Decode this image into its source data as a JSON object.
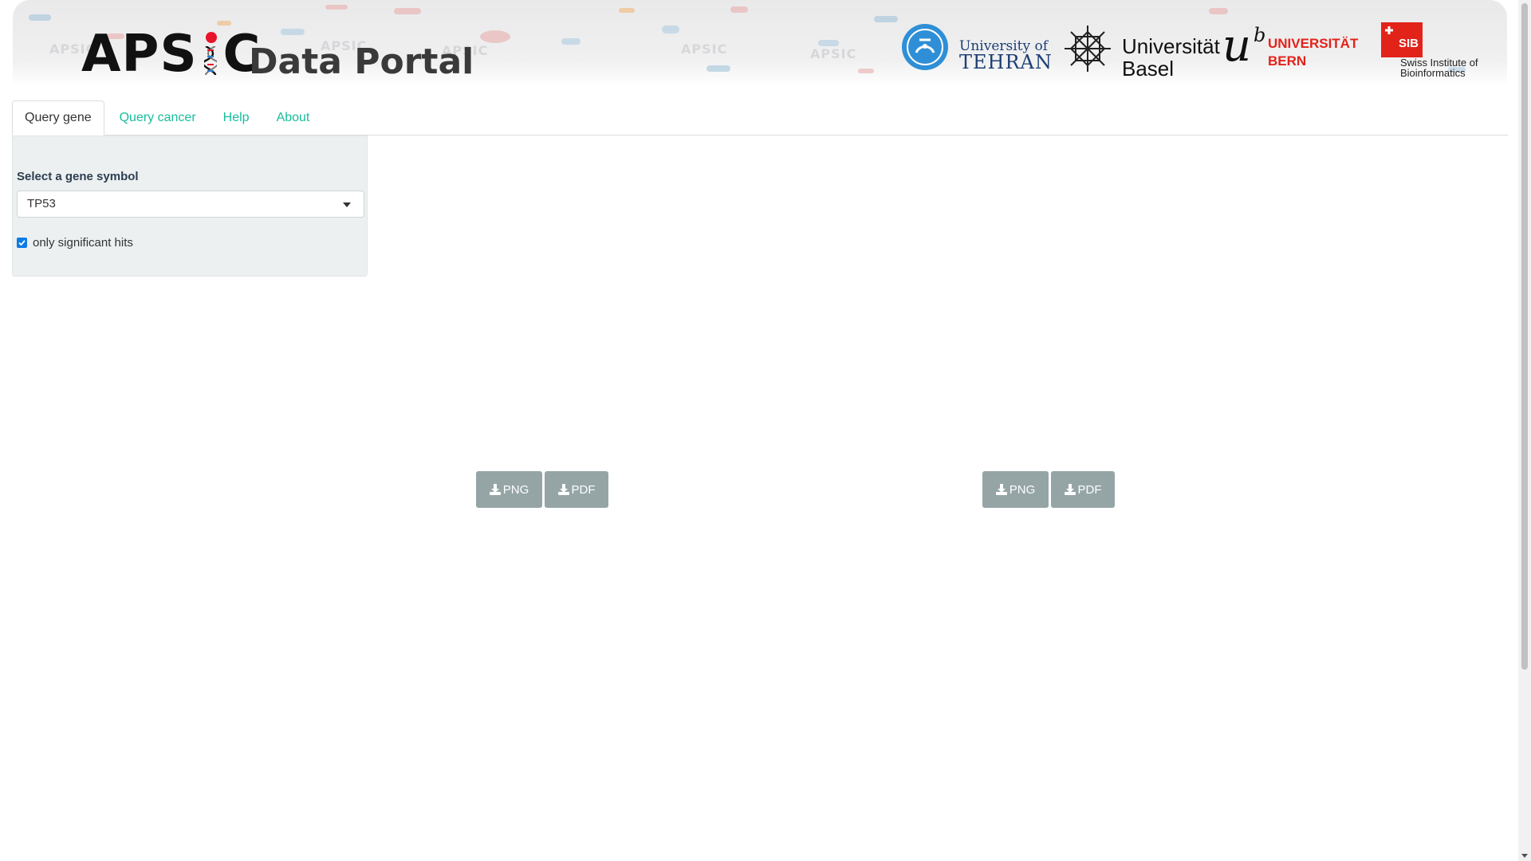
{
  "header": {
    "logo_main": "APSIC",
    "logo_left": "APS",
    "logo_right": "C",
    "logo_sub": "Data Portal",
    "watermark_text": "APSIC",
    "partners": {
      "tehran_line1": "University of",
      "tehran_line2": "TEHRAN",
      "basel_line1": "Universität",
      "basel_line2": "Basel",
      "bern_u": "u",
      "bern_b": "b",
      "bern_line1": "UNIVERSITÄT",
      "bern_line2": "BERN",
      "sib_box": "SIB",
      "sib_line1": "Swiss Institute of",
      "sib_line2": "Bioinformatics"
    },
    "colors": {
      "apsic_dot": "#e8152a",
      "tehran": "#1d3f73",
      "bern": "#e2231a",
      "sib": "#e2231a"
    }
  },
  "tabs": [
    {
      "label": "Query gene",
      "active": true
    },
    {
      "label": "Query cancer",
      "active": false
    },
    {
      "label": "Help",
      "active": false
    },
    {
      "label": "About",
      "active": false
    }
  ],
  "sidebar": {
    "gene_label": "Select a gene symbol",
    "gene_value": "TP53",
    "significant_label": "only significant hits",
    "significant_checked": true
  },
  "downloads": {
    "png_label": "PNG",
    "pdf_label": "PDF"
  },
  "colors": {
    "tab_link": "#18bc9c",
    "sidebar_bg": "#ecf0f1",
    "button_bg": "#95a5a6",
    "checkbox": "#0b7be6"
  },
  "icons": {
    "download": "download-icon",
    "dropdown": "caret-down-icon",
    "check": "check-icon"
  }
}
